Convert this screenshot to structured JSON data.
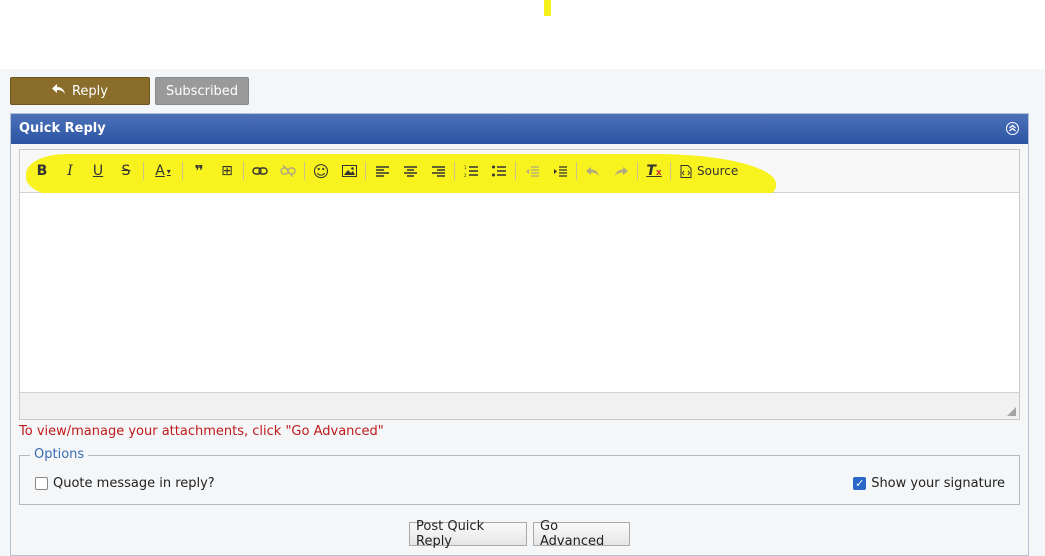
{
  "actions": {
    "reply_label": "Reply",
    "subscribed_label": "Subscribed"
  },
  "quick_reply": {
    "title": "Quick Reply",
    "toolbar": {
      "bold": "B",
      "italic": "I",
      "underline": "U",
      "strike": "S",
      "text_color": "A",
      "quote": "99",
      "insert": "⊞",
      "link": "link-icon",
      "unlink": "unlink-icon",
      "smiley": "☺",
      "image": "image-icon",
      "source_label": "Source"
    },
    "attachments_note": "To view/manage your attachments, click \"Go Advanced\"",
    "options": {
      "legend": "Options",
      "quote_label": "Quote message in reply?",
      "quote_checked": false,
      "signature_label": "Show your signature",
      "signature_checked": true
    },
    "post_label": "Post Quick Reply",
    "advanced_label": "Go Advanced"
  },
  "colors": {
    "header": "#2b54a2",
    "reply_button": "#8b6d2b",
    "highlight": "#f8f21f",
    "note": "#c01b1b"
  }
}
